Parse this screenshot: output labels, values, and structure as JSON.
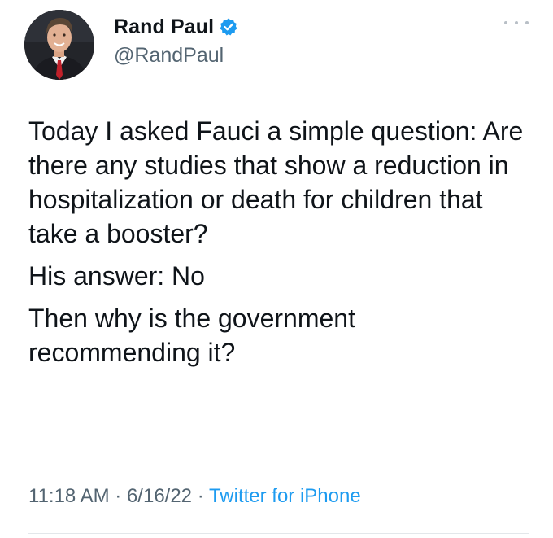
{
  "tweet": {
    "author": {
      "display_name": "Rand Paul",
      "handle": "@RandPaul",
      "verified": true,
      "avatar_icon": "profile-photo"
    },
    "more_icon": "more-horizontal-icon",
    "paragraphs": [
      "Today I asked Fauci a simple question: Are there any studies that show a reduction in hospitalization or death for children that take a booster?",
      "His answer: No",
      "Then why is the government recommending it?"
    ],
    "meta": {
      "time": "11:18 AM",
      "sep1": " · ",
      "date": "6/16/22",
      "sep2": " · ",
      "source": "Twitter for iPhone"
    }
  },
  "colors": {
    "text": "#0f1419",
    "secondary": "#536471",
    "link": "#1d9bf0",
    "verified": "#1d9bf0"
  }
}
